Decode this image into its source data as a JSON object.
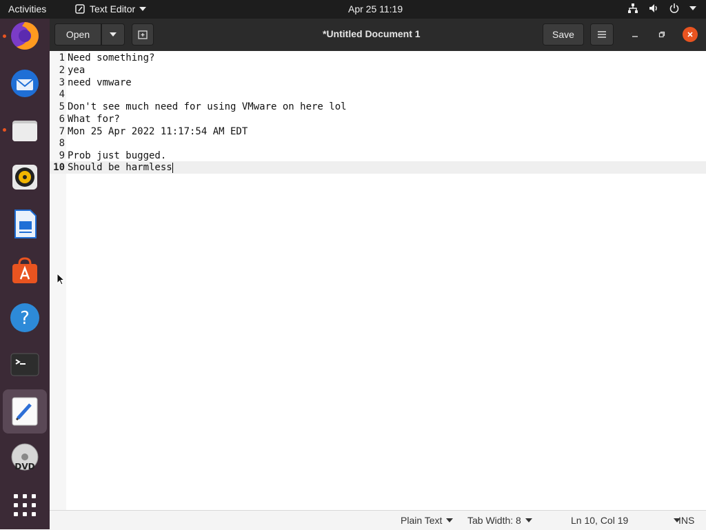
{
  "topbar": {
    "activities": "Activities",
    "app_name": "Text Editor",
    "clock": "Apr 25  11:19"
  },
  "dock": {
    "items": [
      "Firefox",
      "Thunderbird",
      "Files",
      "Rhythmbox",
      "LibreOffice Writer",
      "Ubuntu Software",
      "Help",
      "Terminal",
      "Text Editor",
      "DVD",
      "Show Applications"
    ]
  },
  "header": {
    "open_label": "Open",
    "title": "*Untitled Document 1",
    "save_label": "Save"
  },
  "editor": {
    "lines": [
      {
        "num": "1",
        "text": "Need something?"
      },
      {
        "num": "2",
        "text": "yea"
      },
      {
        "num": "3",
        "text": "need vmware"
      },
      {
        "num": "4",
        "text": ""
      },
      {
        "num": "5",
        "text": "Don't see much need for using VMware on here lol"
      },
      {
        "num": "6",
        "text": "What for?"
      },
      {
        "num": "7",
        "text": "Mon 25 Apr 2022 11:17:54 AM EDT"
      },
      {
        "num": "8",
        "text": ""
      },
      {
        "num": "9",
        "text": "Prob just bugged."
      },
      {
        "num": "10",
        "text": "Should be harmless"
      }
    ]
  },
  "statusbar": {
    "language": "Plain Text",
    "tab_width": "Tab Width: 8",
    "position": "Ln 10, Col 19",
    "mode": "INS"
  }
}
